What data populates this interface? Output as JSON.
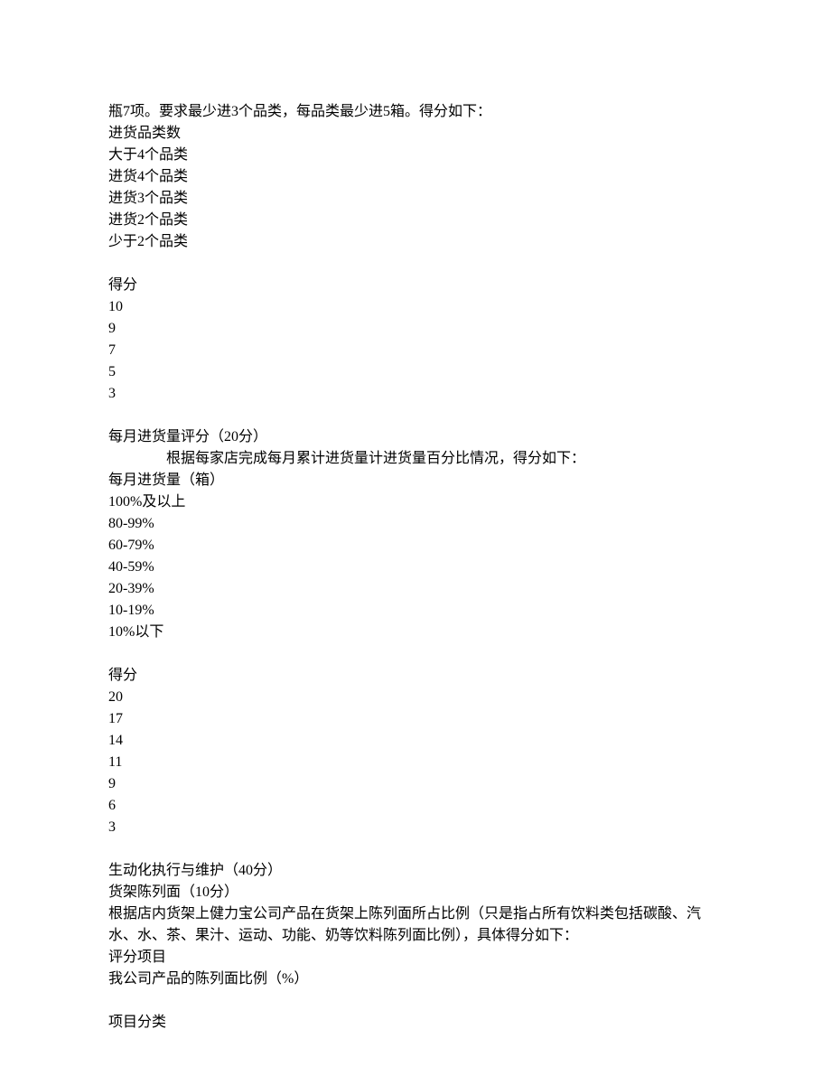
{
  "intro": "瓶7项。要求最少进3个品类，每品类最少进5箱。得分如下：",
  "section1_header": "进货品类数",
  "section1_rows": [
    "大于4个品类",
    "进货4个品类",
    "进货3个品类",
    "进货2个品类",
    "少于2个品类"
  ],
  "score_label": "得分",
  "section1_scores": [
    "10",
    "9",
    "7",
    "5",
    "3"
  ],
  "monthly_title": "每月进货量评分（20分）",
  "monthly_note": "根据每家店完成每月累计进货量计进货量百分比情况，得分如下：",
  "monthly_header": "每月进货量（箱）",
  "monthly_rows": [
    "100%及以上",
    "80-99%",
    "60-79%",
    "40-59%",
    "20-39%",
    "10-19%",
    "10%以下"
  ],
  "monthly_scores": [
    "20",
    "17",
    "14",
    "11",
    "9",
    "6",
    "3"
  ],
  "vivid_title": "生动化执行与维护（40分）",
  "shelf_title": "货架陈列面（10分）",
  "shelf_desc": "根据店内货架上健力宝公司产品在货架上陈列面所占比例（只是指占所有饮料类包括碳酸、汽水、水、茶、果汁、运动、功能、奶等饮料陈列面比例），具体得分如下：",
  "eval_item": "评分项目",
  "eval_ratio": "我公司产品的陈列面比例（%）",
  "eval_category": "项目分类"
}
